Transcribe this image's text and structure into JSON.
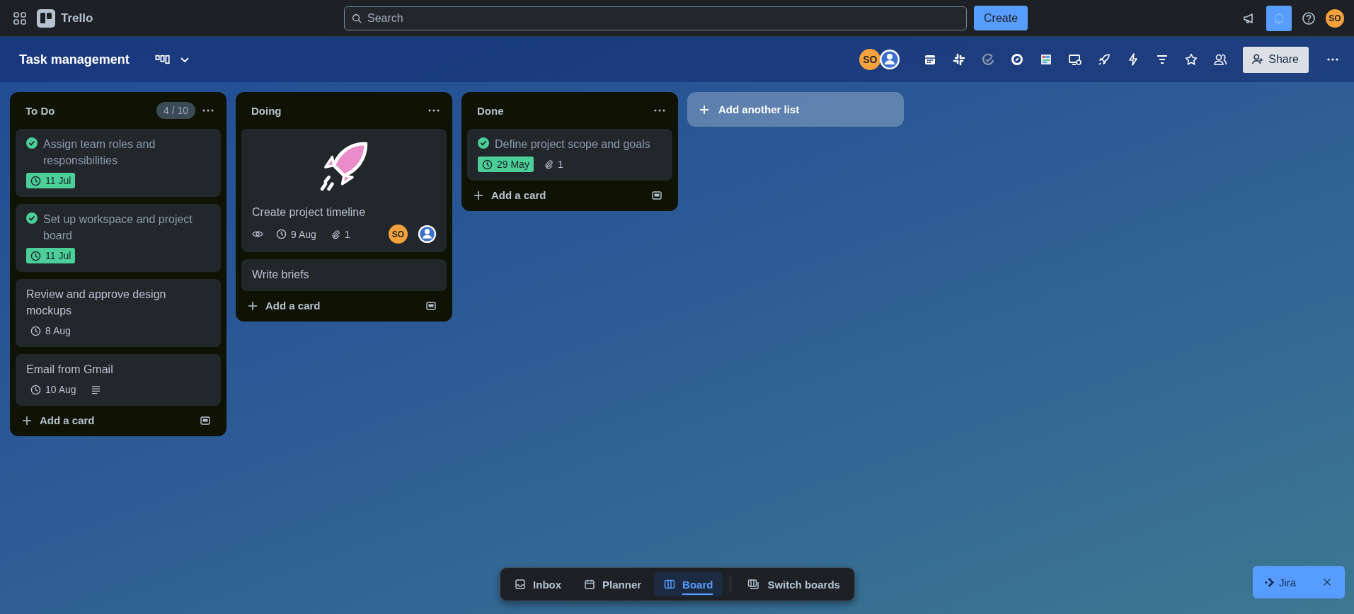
{
  "topbar": {
    "app_name": "Trello",
    "search": {
      "placeholder": "Search"
    },
    "create_label": "Create",
    "avatar": "SO"
  },
  "board": {
    "title": "Task management",
    "members": [
      {
        "kind": "initials",
        "text": "SO"
      },
      {
        "kind": "silhouette"
      }
    ],
    "share_label": "Share"
  },
  "lists": [
    {
      "title": "To Do",
      "count": "4 / 10",
      "add_label": "Add a card",
      "cards": [
        {
          "title": "Assign team roles and responsibilities",
          "completed": true,
          "cover": false,
          "badges": [
            {
              "kind": "due",
              "text": "11 Jul",
              "complete": true
            }
          ]
        },
        {
          "title": "Set up workspace and project board",
          "completed": true,
          "cover": false,
          "badges": [
            {
              "kind": "due",
              "text": "11 Jul",
              "complete": true
            }
          ]
        },
        {
          "title": "Review and approve design mockups",
          "completed": false,
          "cover": false,
          "badges": [
            {
              "kind": "due",
              "text": "8 Aug",
              "complete": false
            }
          ]
        },
        {
          "title": "Email from Gmail",
          "completed": false,
          "cover": false,
          "badges": [
            {
              "kind": "due",
              "text": "10 Aug",
              "complete": false
            },
            {
              "kind": "description"
            }
          ]
        }
      ]
    },
    {
      "title": "Doing",
      "add_label": "Add a card",
      "cards": [
        {
          "title": "Create project timeline",
          "completed": false,
          "cover": true,
          "badges": [
            {
              "kind": "watch"
            },
            {
              "kind": "due",
              "text": "9 Aug",
              "complete": false
            },
            {
              "kind": "attachment",
              "text": "1"
            }
          ],
          "members": [
            {
              "kind": "initials",
              "text": "SO"
            },
            {
              "kind": "silhouette"
            }
          ]
        },
        {
          "title": "Write briefs",
          "completed": false,
          "cover": false
        }
      ]
    },
    {
      "title": "Done",
      "add_label": "Add a card",
      "cards": [
        {
          "title": "Define project scope and goals",
          "completed": true,
          "cover": false,
          "badges": [
            {
              "kind": "due",
              "text": "29 May",
              "complete": true
            },
            {
              "kind": "attachment",
              "text": "1"
            }
          ]
        }
      ]
    }
  ],
  "add_list_label": "Add another list",
  "bottom_nav": [
    {
      "label": "Inbox",
      "selected": false
    },
    {
      "label": "Planner",
      "selected": false
    },
    {
      "label": "Board",
      "selected": true
    },
    {
      "label": "Switch boards",
      "selected": false
    }
  ],
  "jira_button": {
    "label": "Jira"
  }
}
